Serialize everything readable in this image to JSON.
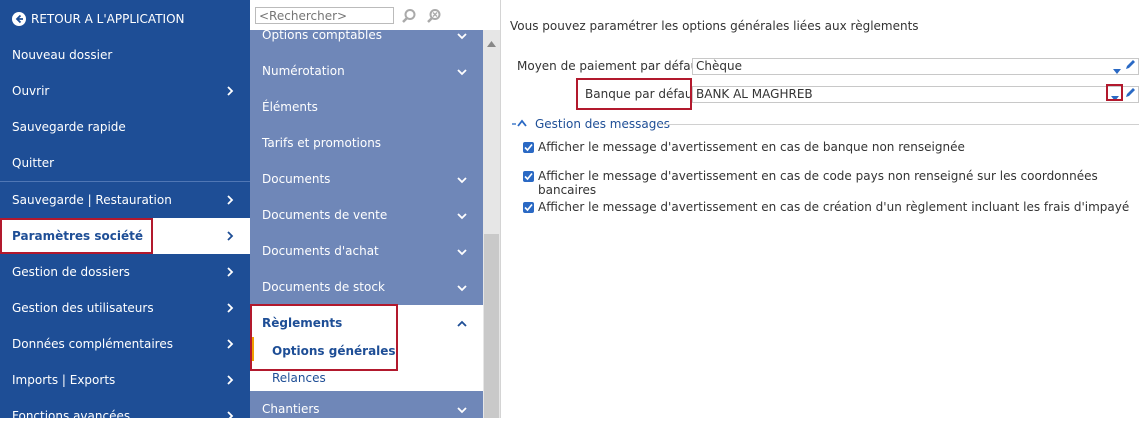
{
  "left_menu": {
    "back_label": "RETOUR A L'APPLICATION",
    "items": [
      {
        "label": "Nouveau dossier"
      },
      {
        "label": "Ouvrir"
      },
      {
        "label": "Sauvegarde rapide"
      },
      {
        "label": "Quitter"
      },
      {
        "label": "Sauvegarde | Restauration"
      },
      {
        "label": "Paramètres société"
      },
      {
        "label": "Gestion de dossiers"
      },
      {
        "label": "Gestion des utilisateurs"
      },
      {
        "label": "Données complémentaires"
      },
      {
        "label": "Imports | Exports"
      },
      {
        "label": "Fonctions avancées"
      }
    ]
  },
  "middle_nav": {
    "search_placeholder": "<Rechercher>",
    "items": [
      {
        "label": "Options comptables"
      },
      {
        "label": "Numérotation"
      },
      {
        "label": "Éléments"
      },
      {
        "label": "Tarifs et promotions"
      },
      {
        "label": "Documents"
      },
      {
        "label": "Documents de vente"
      },
      {
        "label": "Documents d'achat"
      },
      {
        "label": "Documents de stock"
      },
      {
        "label": "Règlements"
      },
      {
        "label": "Options générales"
      },
      {
        "label": "Relances"
      },
      {
        "label": "Chantiers"
      }
    ]
  },
  "content": {
    "intro": "Vous pouvez paramétrer les options générales liées aux règlements",
    "payment_label": "Moyen de paiement par défaut",
    "payment_value": "Chèque",
    "bank_label": "Banque par défaut",
    "bank_value": "BANK AL MAGHREB",
    "section_title": "Gestion des messages",
    "checkboxes": [
      {
        "label": "Afficher le message d'avertissement en cas de banque non renseignée",
        "checked": true
      },
      {
        "label": "Afficher le message d'avertissement en cas de code pays non renseigné sur les coordonnées bancaires",
        "checked": true
      },
      {
        "label": "Afficher le message d'avertissement en cas de création d'un règlement incluant les frais d'impayé",
        "checked": true
      }
    ]
  },
  "colors": {
    "left_bg": "#1e4e96",
    "mid_bg": "#6f87b8",
    "highlight_border": "#b2192d",
    "accent": "#2a69c4"
  }
}
